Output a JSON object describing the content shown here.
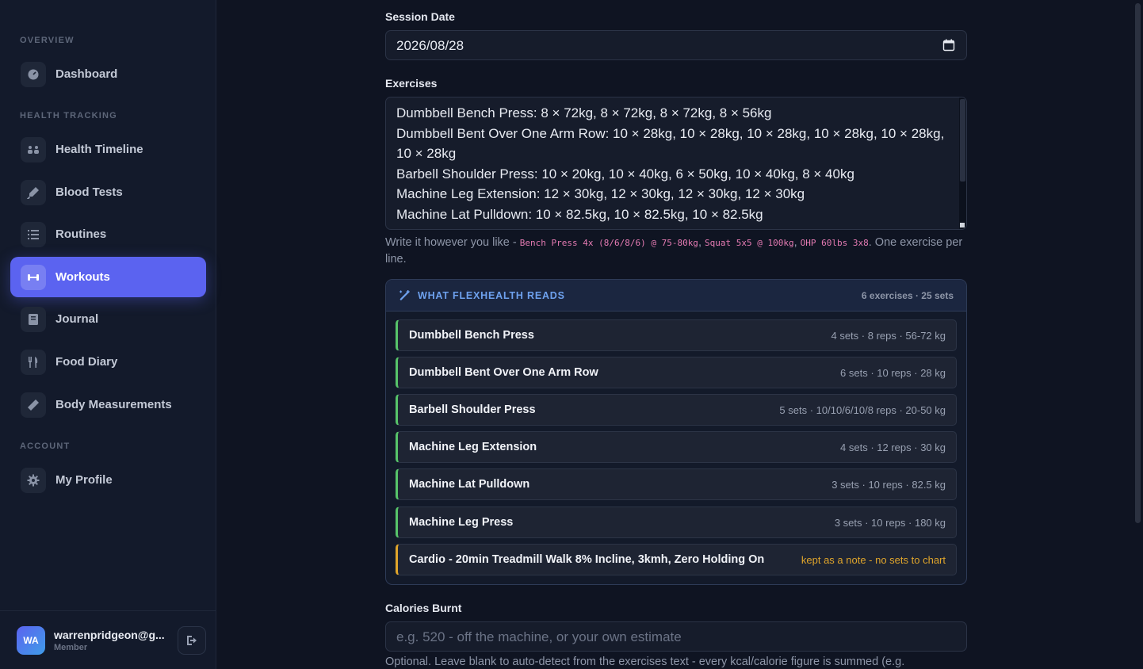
{
  "sidebar": {
    "sections": {
      "overview": "OVERVIEW",
      "health": "HEALTH TRACKING",
      "account": "ACCOUNT"
    },
    "items": [
      {
        "label": "Dashboard",
        "icon": "dashboard-icon"
      },
      {
        "label": "Health Timeline",
        "icon": "timeline-icon"
      },
      {
        "label": "Blood Tests",
        "icon": "syringe-icon"
      },
      {
        "label": "Routines",
        "icon": "list-icon"
      },
      {
        "label": "Workouts",
        "icon": "dumbbell-icon",
        "active": true
      },
      {
        "label": "Journal",
        "icon": "book-icon"
      },
      {
        "label": "Food Diary",
        "icon": "utensils-icon"
      },
      {
        "label": "Body Measurements",
        "icon": "ruler-icon"
      },
      {
        "label": "My Profile",
        "icon": "gear-icon"
      }
    ],
    "user": {
      "initials": "WA",
      "email": "warrenpridgeon@g...",
      "role": "Member"
    }
  },
  "form": {
    "session_date": {
      "label": "Session Date",
      "value": "2026/08/28"
    },
    "exercises": {
      "label": "Exercises",
      "lines": [
        "Dumbbell Bench Press: 8 × 72kg, 8 × 72kg, 8 × 72kg, 8 × 56kg",
        "Dumbbell Bent Over One Arm Row: 10 × 28kg, 10 × 28kg, 10 × 28kg, 10 × 28kg, 10 × 28kg, 10 × 28kg",
        "Barbell Shoulder Press: 10 × 20kg, 10 × 40kg, 6 × 50kg, 10 × 40kg, 8 × 40kg",
        "Machine Leg Extension: 12 × 30kg, 12 × 30kg, 12 × 30kg, 12 × 30kg",
        "Machine Lat Pulldown: 10 × 82.5kg, 10 × 82.5kg, 10 × 82.5kg"
      ],
      "help_prefix": "Write it however you like - ",
      "help_ex1": "Bench Press 4x (8/6/8/6) @ 75-80kg",
      "help_ex2": "Squat 5x5 @ 100kg",
      "help_ex3": "OHP 60lbs 3x8",
      "help_suffix": ". One exercise per line."
    },
    "reads": {
      "title": "WHAT FLEXHEALTH READS",
      "count": "6 exercises · 25 sets",
      "rows": [
        {
          "name": "Dumbbell Bench Press",
          "meta": "4 sets · 8 reps · 56-72 kg"
        },
        {
          "name": "Dumbbell Bent Over One Arm Row",
          "meta": "6 sets · 10 reps · 28 kg"
        },
        {
          "name": "Barbell Shoulder Press",
          "meta": "5 sets · 10/10/6/10/8 reps · 20-50 kg"
        },
        {
          "name": "Machine Leg Extension",
          "meta": "4 sets · 12 reps · 30 kg"
        },
        {
          "name": "Machine Lat Pulldown",
          "meta": "3 sets · 10 reps · 82.5 kg"
        },
        {
          "name": "Machine Leg Press",
          "meta": "3 sets · 10 reps · 180 kg"
        },
        {
          "name": "Cardio - 20min Treadmill Walk 8% Incline, 3kmh, Zero Holding On",
          "meta": "kept as a note - no sets to chart",
          "note": true
        }
      ]
    },
    "calories": {
      "label": "Calories Burnt",
      "placeholder": "e.g. 520 - off the machine, or your own estimate",
      "help": "Optional. Leave blank to auto-detect from the exercises text - every kcal/calorie figure is summed (e.g."
    }
  },
  "colors": {
    "accent": "#5b63f0",
    "set_bar": "#57c46a",
    "note_bar": "#e0a52b",
    "reads_title": "#6ea1ee"
  }
}
